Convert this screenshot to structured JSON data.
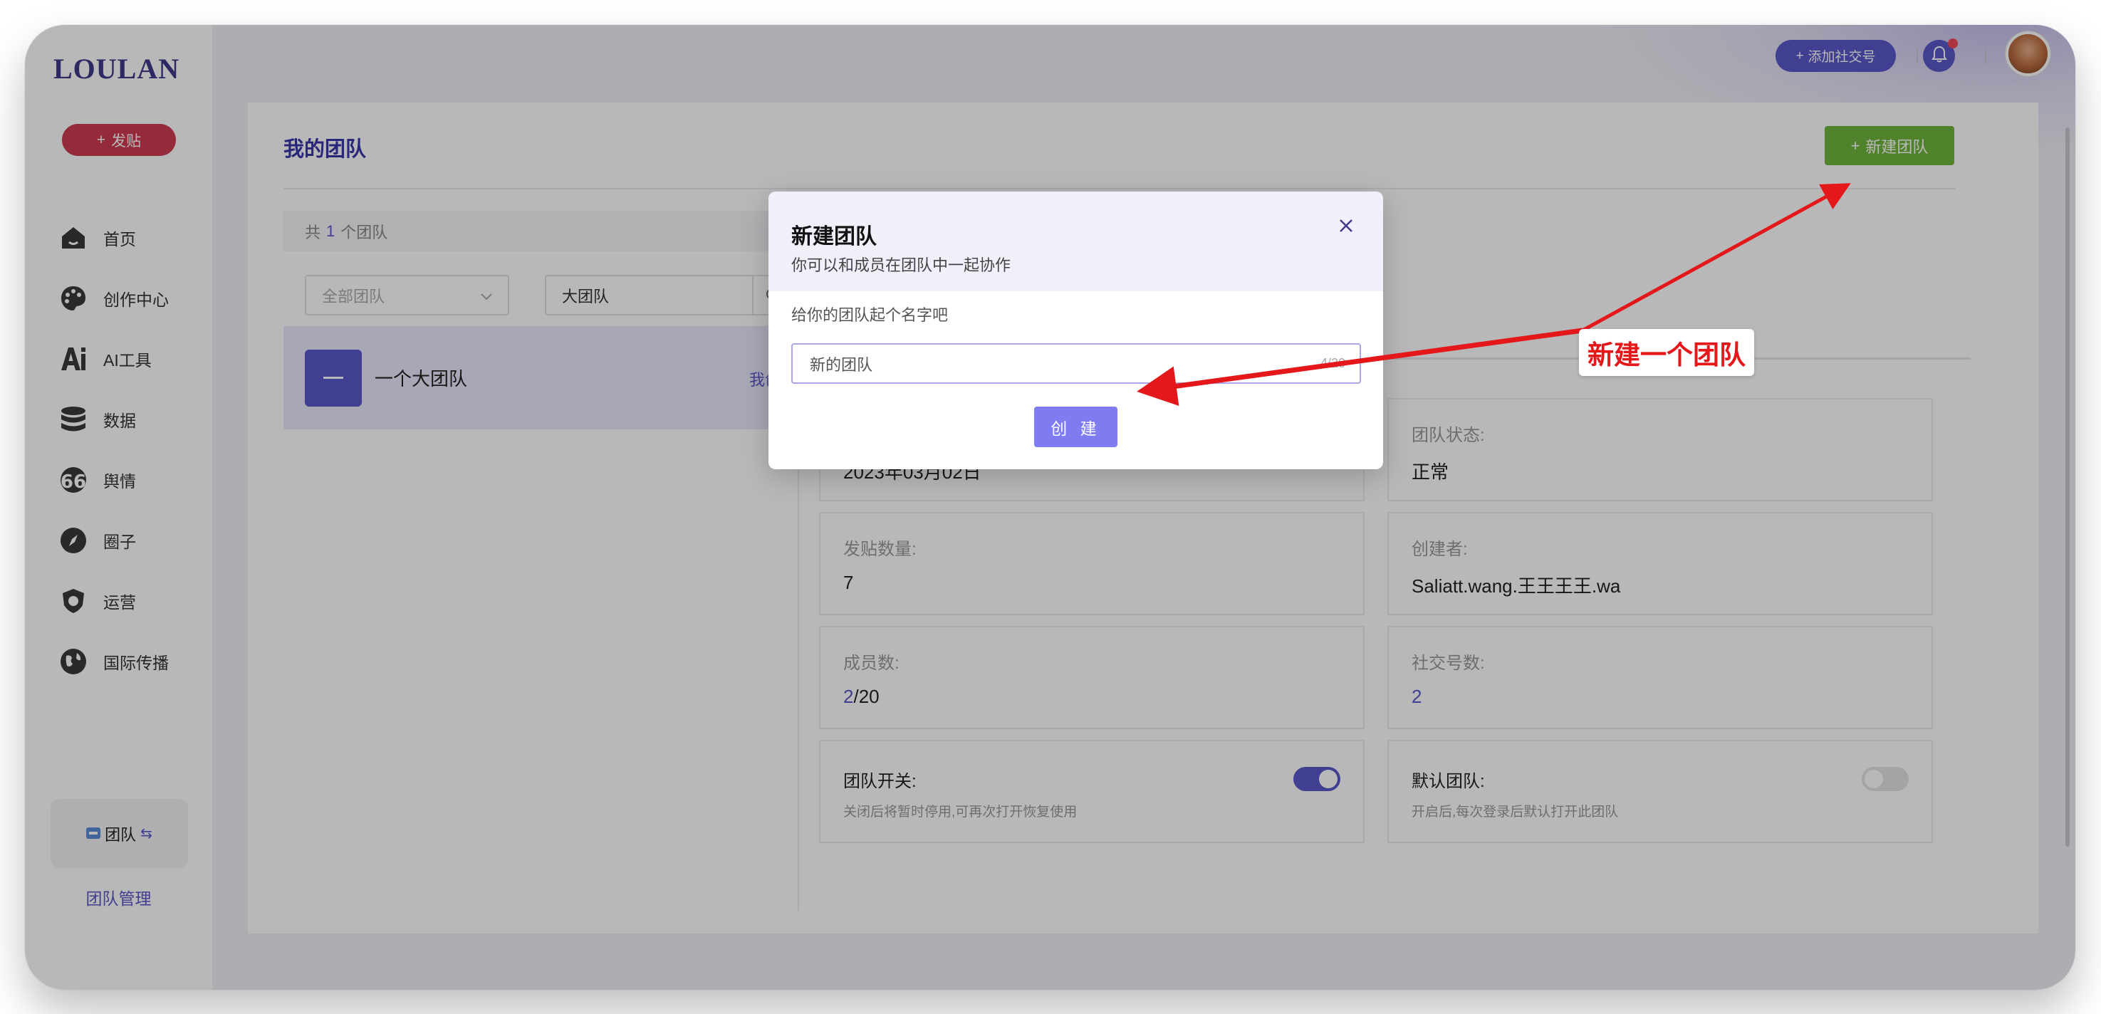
{
  "sidebar": {
    "logo": "LOULAN",
    "post_button": "发贴",
    "nav": [
      {
        "label": "首页",
        "icon": "home-icon"
      },
      {
        "label": "创作中心",
        "icon": "palette-icon"
      },
      {
        "label": "AI工具",
        "icon": "ai-icon"
      },
      {
        "label": "数据",
        "icon": "database-icon"
      },
      {
        "label": "舆情",
        "icon": "quote-icon"
      },
      {
        "label": "圈子",
        "icon": "compass-icon"
      },
      {
        "label": "运营",
        "icon": "shield-icon"
      },
      {
        "label": "国际传播",
        "icon": "globe-icon"
      }
    ],
    "team_switch": "团队",
    "team_manage": "团队管理"
  },
  "header": {
    "add_social": "添加社交号"
  },
  "main": {
    "title": "我的团队",
    "new_team_button": "新建团队",
    "count_prefix": "共",
    "count": "1",
    "count_suffix": "个团队",
    "filter_placeholder": "全部团队",
    "search_value": "大团队",
    "team": {
      "name": "一个大团队",
      "tag": "我创建"
    },
    "info": {
      "created_value": "2023年03月02日",
      "status_label": "团队状态:",
      "status_value": "正常",
      "posts_label": "发贴数量:",
      "posts_value": "7",
      "creator_label": "创建者:",
      "creator_value": "Saliatt.wang.王王王王.wa",
      "members_label": "成员数:",
      "members_current": "2",
      "members_total": "/20",
      "social_label": "社交号数:",
      "social_value": "2",
      "switch_label": "团队开关:",
      "switch_desc": "关闭后将暂时停用,可再次打开恢复使用",
      "switch_on": true,
      "default_label": "默认团队:",
      "default_desc": "开启后,每次登录后默认打开此团队",
      "default_on": false
    }
  },
  "modal": {
    "title": "新建团队",
    "subtitle": "你可以和成员在团队中一起协作",
    "hint": "给你的团队起个名字吧",
    "input_value": "新的团队",
    "counter": "4/20",
    "create_button": "创 建"
  },
  "annotation": {
    "text": "新建一个团队",
    "color": "#e4181a"
  },
  "colors": {
    "accent": "#5b58c9",
    "danger": "#cf3b52",
    "success": "#70b53e"
  }
}
